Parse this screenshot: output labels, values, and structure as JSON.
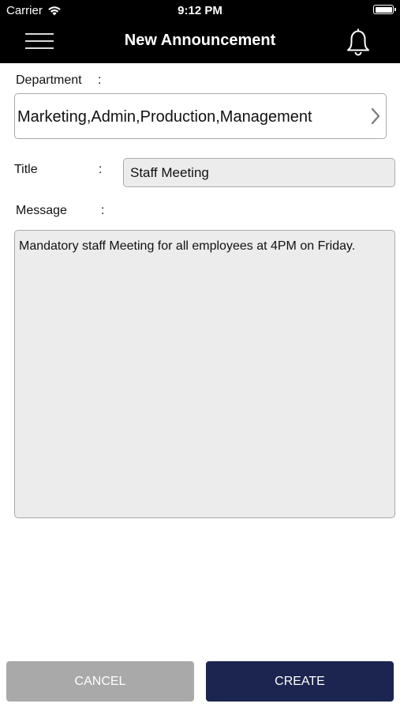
{
  "status_bar": {
    "carrier": "Carrier",
    "time": "9:12 PM"
  },
  "nav": {
    "title": "New Announcement",
    "menu_icon": "hamburger-menu-icon",
    "notification_icon": "bell-icon"
  },
  "form": {
    "department": {
      "label": "Department",
      "colon": ":",
      "value": "Marketing,Admin,Production,Management"
    },
    "title": {
      "label": "Title",
      "colon": ":",
      "value": "Staff Meeting"
    },
    "message": {
      "label": "Message",
      "colon": ":",
      "value": "Mandatory staff Meeting for all employees at 4PM on Friday."
    }
  },
  "actions": {
    "cancel_label": "CANCEL",
    "create_label": "CREATE"
  },
  "colors": {
    "nav_background": "#000000",
    "cancel_button": "#a9a9a9",
    "create_button": "#1c2550",
    "field_background": "#ececec"
  }
}
